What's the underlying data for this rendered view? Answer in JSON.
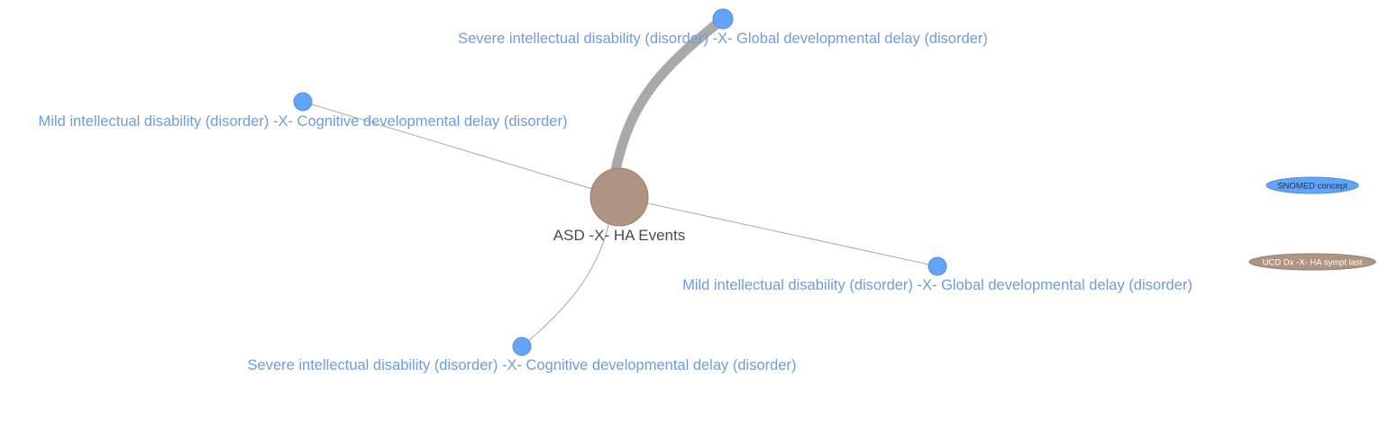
{
  "graph": {
    "center": {
      "label": "ASD -X- HA Events"
    },
    "nodes": [
      {
        "label": "Severe intellectual disability (disorder) -X- Global developmental delay (disorder)"
      },
      {
        "label": "Mild intellectual disability (disorder) -X- Cognitive developmental delay (disorder)"
      },
      {
        "label": "Mild intellectual disability (disorder) -X- Global developmental delay (disorder)"
      },
      {
        "label": "Severe intellectual disability (disorder) -X- Cognitive developmental delay (disorder)"
      }
    ]
  },
  "legend": {
    "items": [
      {
        "label": "SNOMED concept",
        "color": "#63a3f8"
      },
      {
        "label": "UCD Dx -X- HA sympt last",
        "color": "#b09483"
      }
    ]
  },
  "colors": {
    "snomed_node": "#63a3f8",
    "center_node": "#b09483",
    "edge": "#a9a9a9",
    "node_label": "#6f9cde",
    "center_label": "#4a4a4a"
  }
}
